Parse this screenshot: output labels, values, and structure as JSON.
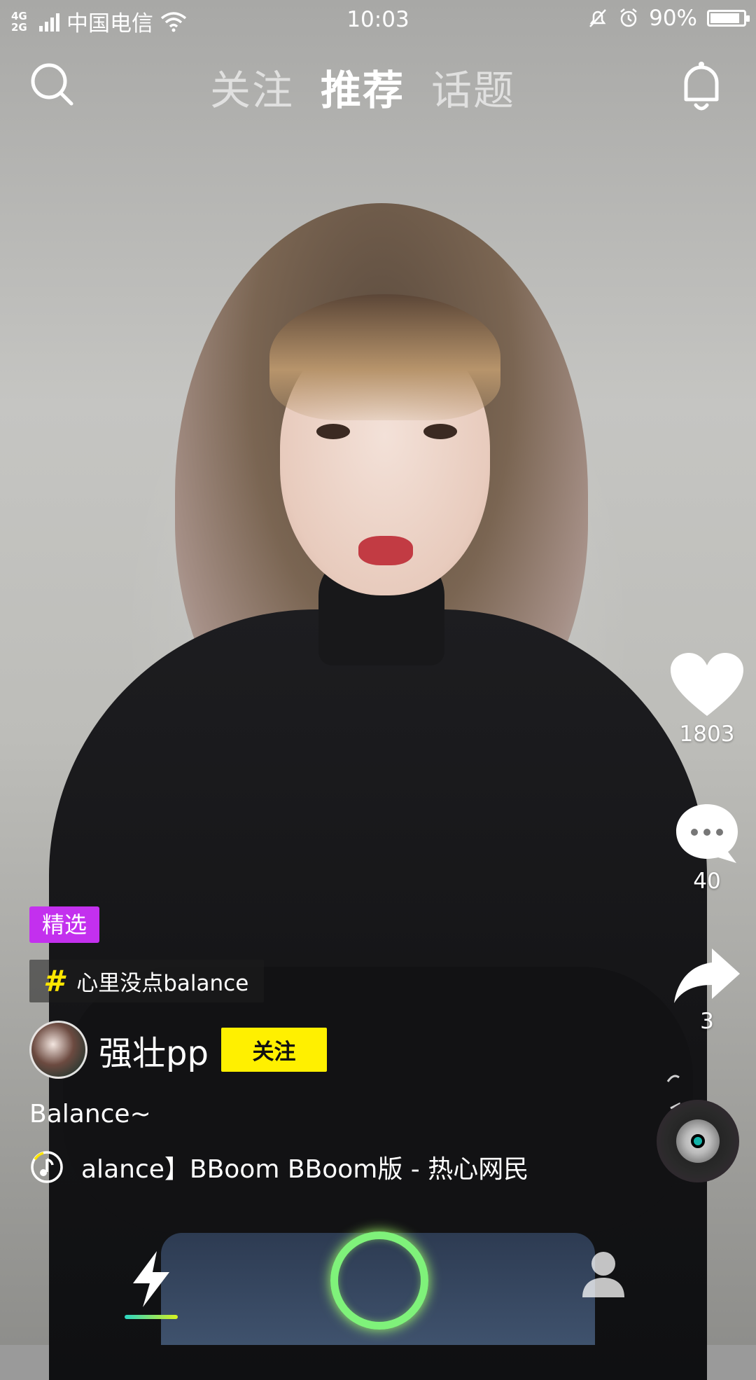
{
  "status_bar": {
    "network": "4G 2G",
    "carrier": "中国电信",
    "time": "10:03",
    "battery": "90%",
    "battery_level": 0.9
  },
  "top_nav": {
    "tabs": [
      {
        "label": "关注",
        "active": false
      },
      {
        "label": "推荐",
        "active": true
      },
      {
        "label": "话题",
        "active": false
      }
    ],
    "search_icon": "search-icon",
    "bell_icon": "bell-icon"
  },
  "actions": {
    "like_count": "1803",
    "comment_count": "40",
    "share_count": "3"
  },
  "post": {
    "badge": "精选",
    "topic": "心里没点balance",
    "author": "强壮pp",
    "follow_label": "关注",
    "caption": "Balance~",
    "music": "alance】BBoom BBoom版 - 热心网民"
  },
  "colors": {
    "badge": "#c330ee",
    "follow": "#fff000",
    "topic_hash": "#ffe600",
    "record_ring": "#7ff27a",
    "tab_indicator_start": "#2bd6c4",
    "tab_indicator_end": "#d9f21e"
  }
}
